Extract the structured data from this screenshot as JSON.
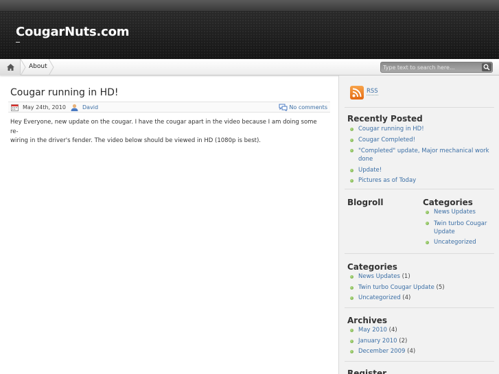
{
  "site": {
    "title": "CougarNuts.com"
  },
  "nav": {
    "items": [
      {
        "label": "About"
      }
    ],
    "search": {
      "placeholder": "Type text to search here..."
    }
  },
  "post": {
    "title": "Cougar running in HD!",
    "date": "May 24th, 2010",
    "author": "David",
    "comments": "No comments",
    "body_line1": "Hey Everyone, new update on the cougar. I have the cougar apart in the video because I am doing some re-",
    "body_line2": "wiring in the driver's fender. The video below should be viewed in HD (1080p is best)."
  },
  "sidebar": {
    "rss_label": "RSS",
    "recent": {
      "title": "Recently Posted",
      "items": [
        {
          "label": "Cougar running in HD!"
        },
        {
          "label": "Cougar Completed!"
        },
        {
          "label": "\"Completed\" update, Major mechanical work done"
        },
        {
          "label": "Update!"
        },
        {
          "label": "Pictures as of Today"
        }
      ]
    },
    "blogroll": {
      "title": "Blogroll"
    },
    "categories_small": {
      "title": "Categories",
      "items": [
        {
          "label": "News Updates"
        },
        {
          "label": "Twin turbo Cougar Update"
        },
        {
          "label": "Uncategorized"
        }
      ]
    },
    "categories": {
      "title": "Categories",
      "items": [
        {
          "label": "News Updates",
          "count": "(1)"
        },
        {
          "label": "Twin turbo Cougar Update",
          "count": "(5)"
        },
        {
          "label": "Uncategorized",
          "count": "(4)"
        }
      ]
    },
    "archives": {
      "title": "Archives",
      "items": [
        {
          "label": "May 2010",
          "count": "(4)"
        },
        {
          "label": "January 2010",
          "count": "(2)"
        },
        {
          "label": "December 2009",
          "count": "(4)"
        }
      ]
    },
    "register": {
      "title": "Register"
    }
  },
  "colors": {
    "link": "#3a6ea5",
    "bullet": "#7ab648",
    "rss": "#f08a2b"
  }
}
